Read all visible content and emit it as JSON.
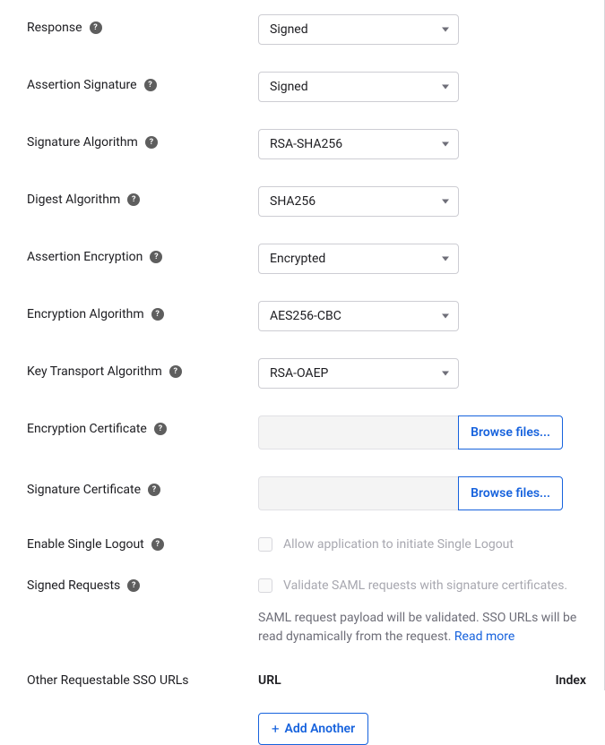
{
  "fields": {
    "response": {
      "label": "Response",
      "value": "Signed"
    },
    "assertion_signature": {
      "label": "Assertion Signature",
      "value": "Signed"
    },
    "signature_algorithm": {
      "label": "Signature Algorithm",
      "value": "RSA-SHA256"
    },
    "digest_algorithm": {
      "label": "Digest Algorithm",
      "value": "SHA256"
    },
    "assertion_encryption": {
      "label": "Assertion Encryption",
      "value": "Encrypted"
    },
    "encryption_algorithm": {
      "label": "Encryption Algorithm",
      "value": "AES256-CBC"
    },
    "key_transport_algorithm": {
      "label": "Key Transport Algorithm",
      "value": "RSA-OAEP"
    },
    "encryption_certificate": {
      "label": "Encryption Certificate",
      "browse": "Browse files..."
    },
    "signature_certificate": {
      "label": "Signature Certificate",
      "browse": "Browse files..."
    },
    "enable_single_logout": {
      "label": "Enable Single Logout",
      "checkbox_label": "Allow application to initiate Single Logout"
    },
    "signed_requests": {
      "label": "Signed Requests",
      "checkbox_label": "Validate SAML requests with signature certificates.",
      "description_prefix": "SAML request payload will be validated. SSO URLs will be read dynamically from the request. ",
      "read_more": "Read more"
    },
    "other_sso_urls": {
      "label": "Other Requestable SSO URLs",
      "col_url": "URL",
      "col_index": "Index",
      "add_button": "Add Another"
    }
  }
}
